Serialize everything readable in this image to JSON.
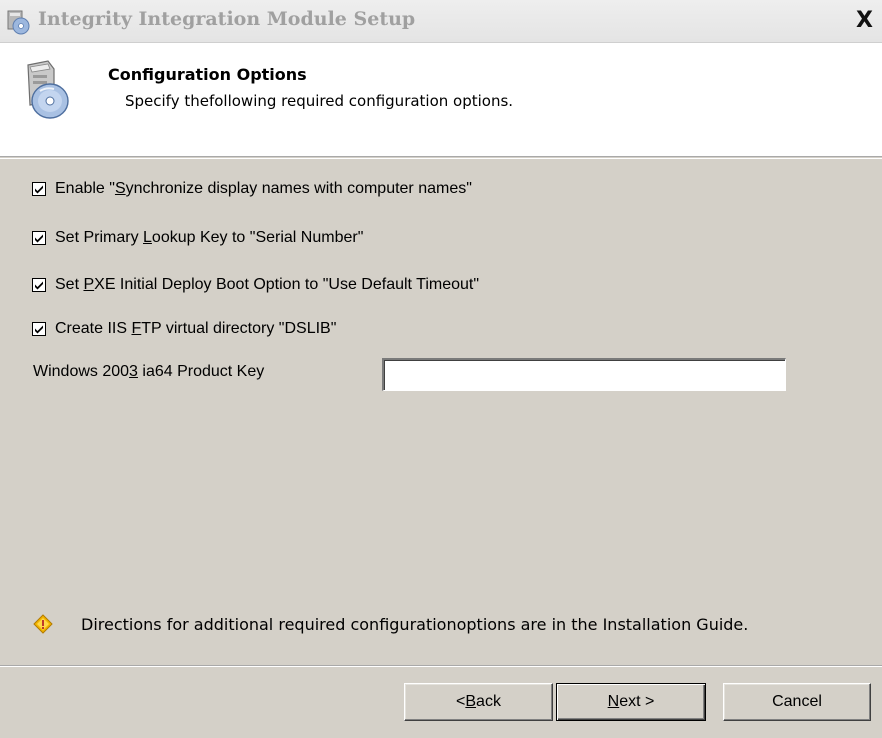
{
  "window": {
    "title": "Integrity Integration Module Setup",
    "close_label": "X"
  },
  "header": {
    "title": "Configuration Options",
    "subtitle": "Specify thefollowing required configuration options."
  },
  "options": [
    {
      "pre": "Enable \"",
      "accel": "S",
      "post": "ynchronize display names with computer names\"",
      "checked": true
    },
    {
      "pre": "Set Primary ",
      "accel": "L",
      "post": "ookup Key to \"Serial Number\"",
      "checked": true
    },
    {
      "pre": "Set ",
      "accel": "P",
      "post": "XE Initial Deploy Boot Option to \"Use Default Timeout\"",
      "checked": true
    },
    {
      "pre": "Create IIS ",
      "accel": "F",
      "post": "TP virtual directory \"DSLIB\"",
      "checked": true
    }
  ],
  "product_key": {
    "label_pre": "Windows 200",
    "label_accel": "3",
    "label_post": " ia64 Product Key",
    "value": ""
  },
  "info_text": "Directions for additional required configurationoptions are in the Installation Guide.",
  "buttons": {
    "back": {
      "pre": "< ",
      "accel": "B",
      "post": "ack"
    },
    "next": {
      "pre": "",
      "accel": "N",
      "post": "ext >"
    },
    "cancel": "Cancel"
  },
  "icons": {
    "title": "setup-cd-icon",
    "header": "setup-cd-icon",
    "checkbox": "checkmark-icon",
    "info": "warning-diamond-icon"
  }
}
